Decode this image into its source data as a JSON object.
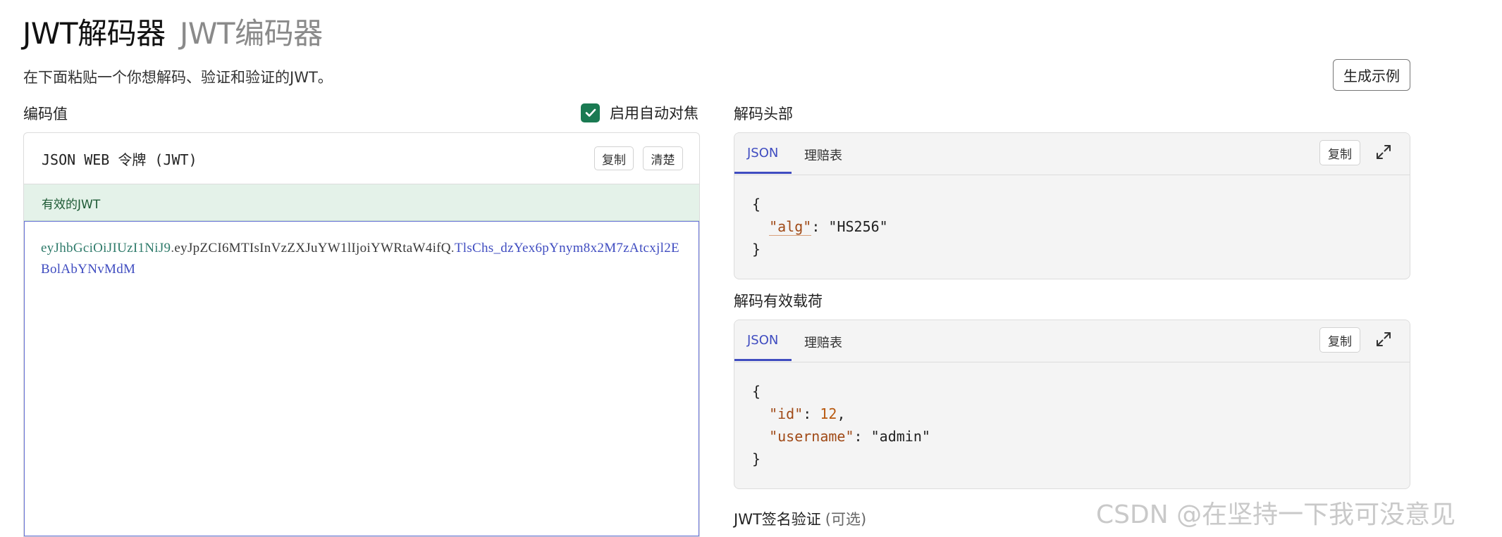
{
  "tabs": {
    "decoder": "JWT解码器",
    "encoder": "JWT编码器"
  },
  "subtitle": "在下面粘贴一个你想解码、验证和验证的JWT。",
  "generate_example": "生成示例",
  "encoded": {
    "label": "编码值",
    "auto_focus_label": "启用自动对焦",
    "auto_focus_checked": true,
    "card_title": "JSON WEB 令牌 (JWT)",
    "copy": "复制",
    "clear": "清楚",
    "status": "有效的JWT",
    "token": {
      "header": "eyJhbGciOiJIUzI1NiJ9",
      "dot1": ".",
      "payload": "eyJpZCI6MTIsInVzZXJuYW1lIjoiYWRtaW4ifQ",
      "dot2": ".",
      "signature": "TlsChs_dzYex6pYnym8x2M7zAtcxjl2EBolAbYNvMdM"
    }
  },
  "decoded_header": {
    "label": "解码头部",
    "tab_json": "JSON",
    "tab_claims": "理赔表",
    "copy": "复制",
    "json": {
      "alg_key": "\"alg\"",
      "alg_value": "\"HS256\""
    }
  },
  "decoded_payload": {
    "label": "解码有效载荷",
    "tab_json": "JSON",
    "tab_claims": "理赔表",
    "copy": "复制",
    "json": {
      "id_key": "\"id\"",
      "id_value": "12",
      "username_key": "\"username\"",
      "username_value": "\"admin\""
    }
  },
  "signature": {
    "label": "JWT签名验证",
    "optional": "(可选)"
  },
  "watermark": "CSDN @在坚持一下我可没意见",
  "colors": {
    "accent": "#3f4cc0",
    "valid_bg": "#e4f2e9",
    "checkbox": "#1a7a52"
  }
}
